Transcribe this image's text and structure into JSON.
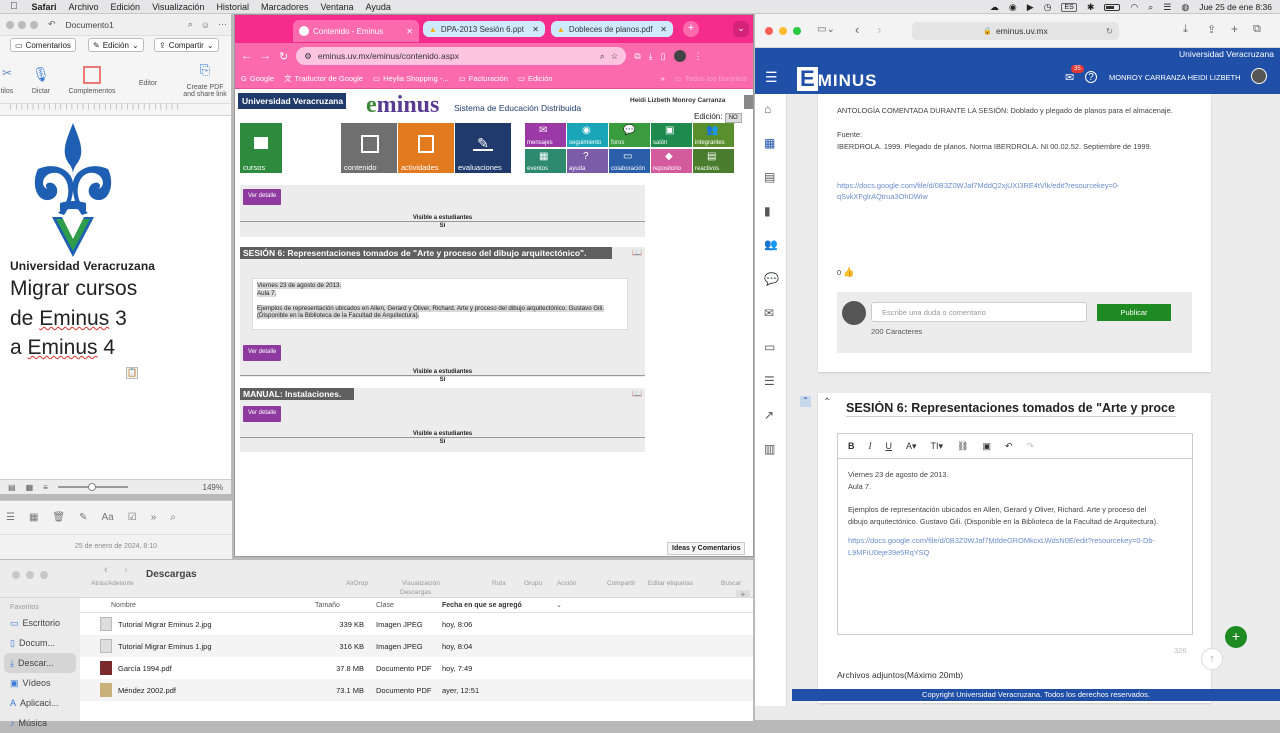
{
  "menubar": {
    "app": "Safari",
    "items": [
      "Archivo",
      "Edición",
      "Visualización",
      "Historial",
      "Marcadores",
      "Ventana",
      "Ayuda"
    ],
    "input_source": "ES",
    "clock": "Jue 25 de ene  8:36"
  },
  "word": {
    "doc_title": "Documento1",
    "buttons": {
      "comments": "Comentarios",
      "edit": "Edición",
      "share": "Compartir"
    },
    "ribbon": {
      "editor": "Editor",
      "dictate": "Dictar",
      "add_ins": "Complementos",
      "create_pdf": "Create PDF and share link",
      "styles_partial": "tilos"
    },
    "doc": {
      "uv_name": "Universidad Veracruzana",
      "line1": "Migrar cursos",
      "line2": "de Eminus 3",
      "line3": "a Eminus 4"
    },
    "zoom": "149%"
  },
  "notes": {
    "date": "25 de enero de 2024, 8:10"
  },
  "chrome": {
    "tabs": [
      {
        "title": "Contenido - Eminus",
        "active": true
      },
      {
        "title": "DPA-2013 Sesión 6.ppt",
        "active": false
      },
      {
        "title": "Dobleces de planos.pdf",
        "active": false
      }
    ],
    "url": "eminus.uv.mx/eminus/contenido.aspx",
    "bookmarks": [
      "Google",
      "Traductor de Google",
      "Heylia Shopping -...",
      "Facturación",
      "Edición",
      "Todos los favoritos"
    ],
    "eminus3": {
      "uv": "Universidad Veracruzana",
      "logo_e": "e",
      "logo_rest": "minus",
      "subtitle": "Sistema de Educación Distribuida",
      "user": "Heidi Lizbeth Monroy Carranza",
      "edicion_label": "Edición:",
      "edicion_value": "NO",
      "big_icons": [
        "cursos",
        "contenido",
        "actividades",
        "evaluaciones"
      ],
      "small_icons_row1": [
        "mensajes",
        "seguimiento",
        "foros",
        "salón",
        "integrantes"
      ],
      "small_icons_row2": [
        "eventos",
        "ayuda",
        "colaboración",
        "repositorio",
        "reactivos"
      ],
      "ver_detalle": "Ver detalle",
      "visible": "Visible a estudiantes",
      "si": "Sí",
      "session6_title": "SESIÓN 6: Representaciones tomados de \"Arte y proceso del dibujo arquitectónico\".",
      "session6_line1": "Viernes 23 de agosto de 2013.",
      "session6_line2": "Aula 7.",
      "session6_body": "Ejemplos de representación ubicados en Allen, Gerard y Oliver, Richard. Arte y proceso del dibujo arquitectónico. Gustavo Gili. (Disponible en la Biblioteca de la Facultad de Arquitectura).",
      "manual_title": "MANUAL: Instalaciones.",
      "ideas": "Ideas y Comentarios"
    }
  },
  "finder": {
    "title": "Descargas",
    "nav_label": "Atrás/Adelante",
    "tools": [
      "AirDrop",
      "Visualización",
      "Ruta",
      "Grupo",
      "Acción",
      "Compartir",
      "Editar etiquetas",
      "Buscar"
    ],
    "path_label": "Descargas",
    "sidebar": {
      "header": "Favoritos",
      "items": [
        "Escritorio",
        "Docum...",
        "Descar...",
        "Vídeos",
        "Aplicaci...",
        "Música"
      ]
    },
    "columns": [
      "Nombre",
      "Tamaño",
      "Clase",
      "Fecha en que se agregó"
    ],
    "rows": [
      {
        "name": "Tutorial Migrar Eminus 2.jpg",
        "size": "339 KB",
        "kind": "Imagen JPEG",
        "date": "hoy, 8:06"
      },
      {
        "name": "Tutorial Migrar Eminus 1.jpg",
        "size": "316 KB",
        "kind": "Imagen JPEG",
        "date": "hoy, 8:04"
      },
      {
        "name": "García 1994.pdf",
        "size": "37.8 MB",
        "kind": "Documento PDF",
        "date": "hoy, 7:49"
      },
      {
        "name": "Méndez 2002.pdf",
        "size": "73.1 MB",
        "kind": "Documento PDF",
        "date": "ayer, 12:51"
      }
    ]
  },
  "safari": {
    "url": "eminus.uv.mx",
    "eminus4": {
      "top_banner": "Universidad Veracruzana",
      "logo_e": "E",
      "logo_rest": "MINUS",
      "notif_count": "35",
      "user": "MONROY CARRANZA HEIDI LIZBETH",
      "card1": {
        "antologia": "ANTOLOGÍA COMENTADA DURANTE LA SESIÓN: Doblado y plegado de planos para el almacenaje.",
        "fuente_label": "Fuente:",
        "fuente": "IBERDROLA. 1999. Plegado de planos. Norma IBERDROLA. NI 00.02.52. Septiembre de 1999.",
        "link_line1": "https://docs.google.com/file/d/0B3Z0WJaf7MddQ2xjUXI3RE4tVlk/edit?resourcekey=0-",
        "link_line2": "qSvkXFglrAQtrua3OhDWiw",
        "likes": "0",
        "comment_placeholder": "Escribe una duda o comentario",
        "publish": "Publicar",
        "char_count": "200 Caracteres"
      },
      "card2": {
        "title": "SESIÓN 6: Representaciones tomados de \"Arte y proce",
        "line1": "Viernes 23 de agosto de 2013.",
        "line2": "Aula 7.",
        "body1": "Ejemplos de representación ubicados en Allen, Gerard y Oliver, Richard. Arte y proceso del",
        "body2": "dibujo arquitectónico. Gustavo Gili. (Disponible en la Biblioteca de la Facultad de Arquitectura).",
        "link_line1": "https://docs.google.com/file/d/0B3Z0WJaf7MddeGROMkcxLWdsN0E/edit?resourcekey=0-Db-",
        "link_line2": "L9MFiU0eje39e5RqYSQ",
        "counter": "326",
        "attachments": "Archivos adjuntos(Máximo 20mb)"
      },
      "footer": "Copyright Universidad Veracruzana. Todos los derechos reservados."
    }
  }
}
